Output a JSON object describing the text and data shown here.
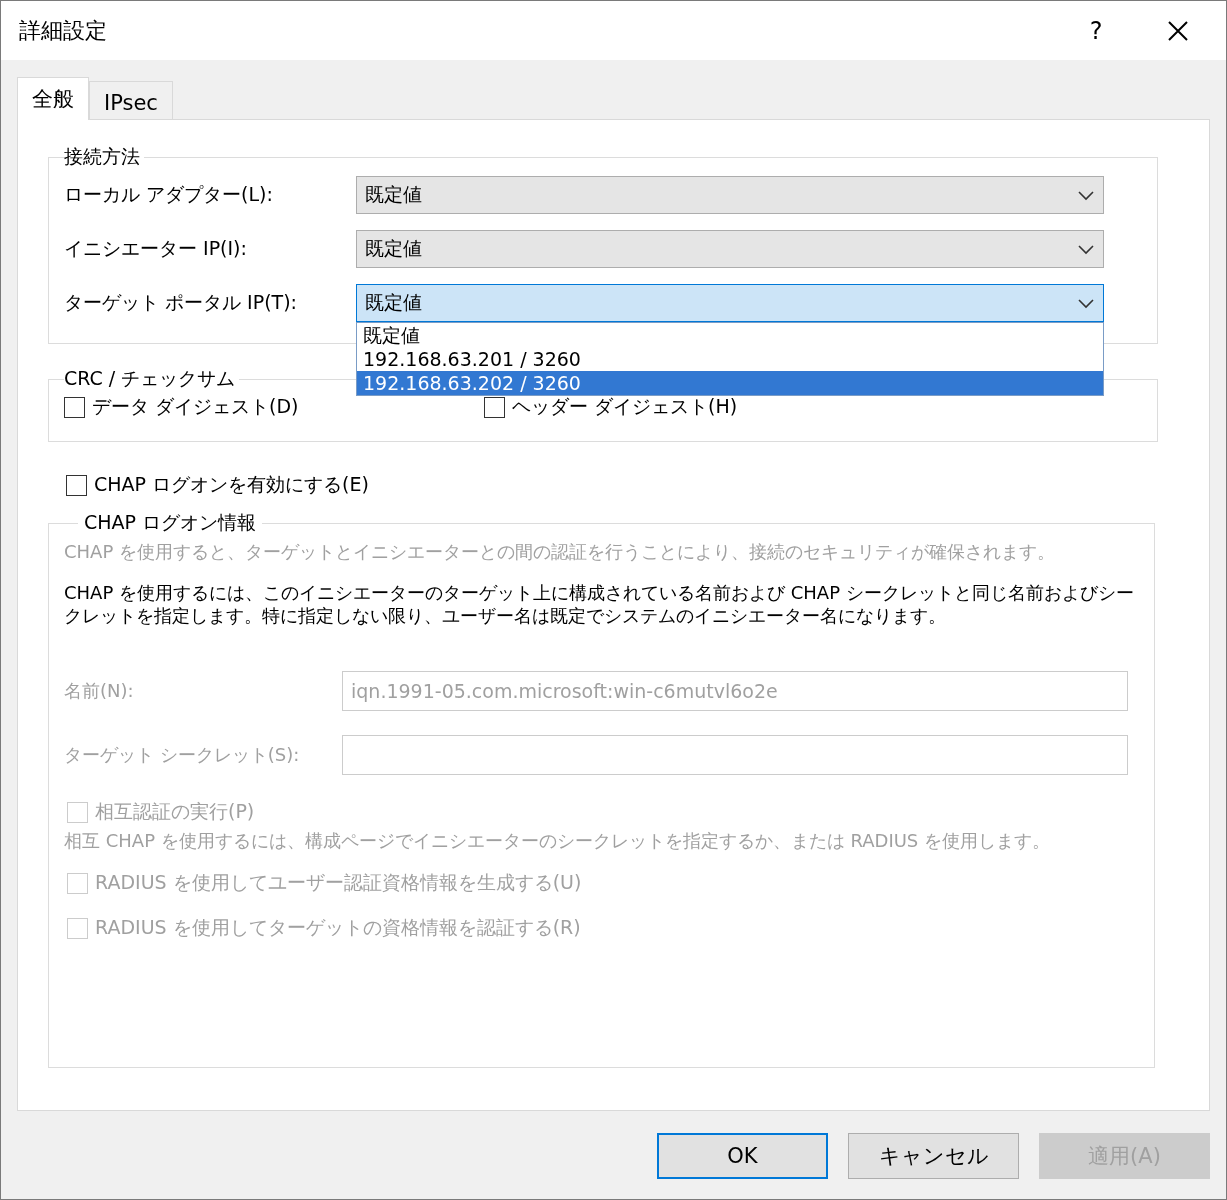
{
  "window": {
    "title": "詳細設定",
    "help": "?"
  },
  "tabs": [
    {
      "label": "全般",
      "selected": true
    },
    {
      "label": "IPsec",
      "selected": false
    }
  ],
  "connection": {
    "title": "接続方法",
    "rows": [
      {
        "label": "ローカル アダプター(L):",
        "value": "既定値",
        "focused": false
      },
      {
        "label": "イニシエーター IP(I):",
        "value": "既定値",
        "focused": false
      },
      {
        "label": "ターゲット ポータル IP(T):",
        "value": "既定値",
        "focused": true
      }
    ]
  },
  "dropdown": {
    "items": [
      {
        "label": "既定値",
        "selected": false
      },
      {
        "label": "192.168.63.201 / 3260",
        "selected": false
      },
      {
        "label": "192.168.63.202 / 3260",
        "selected": true
      }
    ]
  },
  "crc": {
    "title": "CRC / チェックサム",
    "options": [
      {
        "label": "データ ダイジェスト(D)",
        "checked": false
      },
      {
        "label": "ヘッダー ダイジェスト(H)",
        "checked": false
      }
    ]
  },
  "chap_enable": {
    "label": "CHAP ログオンを有効にする(E)",
    "checked": false
  },
  "chap": {
    "title": "CHAP ログオン情報",
    "disabled": true,
    "description": "CHAP を使用すると、ターゲットとイニシエーターとの間の認証を行うことにより、接続のセキュリティが確保されます。",
    "instructions": "CHAP を使用するには、このイニシエーターのターゲット上に構成されている名前および CHAP シークレットと同じ名前およびシークレットを指定します。特に指定しない限り、ユーザー名は既定でシステムのイニシエーター名になります。",
    "fields": [
      {
        "label": "名前(N):",
        "value": "iqn.1991-05.com.microsoft:win-c6mutvl6o2e"
      },
      {
        "label": "ターゲット シークレット(S):"
      }
    ],
    "mutual": {
      "label": "相互認証の実行(P)",
      "checked": false
    },
    "mutual_note": "相互 CHAP を使用するには、構成ページでイニシエーターのシークレットを指定するか、または RADIUS を使用します。",
    "radius_options": [
      {
        "label": "RADIUS を使用してユーザー認証資格情報を生成する(U)",
        "checked": false
      },
      {
        "label": "RADIUS を使用してターゲットの資格情報を認証する(R)",
        "checked": false
      }
    ]
  },
  "buttons": [
    {
      "label": "OK",
      "default": true,
      "disabled": false
    },
    {
      "label": "キャンセル",
      "default": false,
      "disabled": false
    },
    {
      "label": "適用(A)",
      "default": false,
      "disabled": true
    }
  ]
}
